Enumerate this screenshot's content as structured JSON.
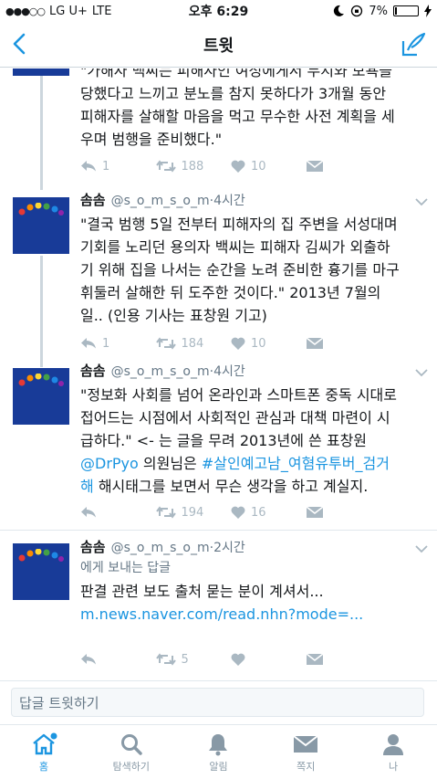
{
  "status_bar": {
    "signal": "●●●○○",
    "carrier": "LG U+",
    "network": "LTE",
    "time": "오후 6:29",
    "battery": "7%",
    "battery_level": 0.07
  },
  "nav": {
    "title": "트윗"
  },
  "tweets": [
    {
      "body_lines": [
        "\"가해자 백씨는 피해자인 여성에게서 무시와 모욕을",
        "당했다고 느끼고 분노를 참지 못하다가 3개월 동안",
        "피해자를 살해할 마음을 먹고 무수한 사전 계획을 세",
        "우며 범행을 준비했다.\""
      ],
      "reply_count": "1",
      "retweet_count": "188",
      "like_count": "10"
    },
    {
      "name": "솜솜",
      "handle": "@s_o_m_s_o_m",
      "time": "4시간",
      "body_lines": [
        "\"결국 범행 5일 전부터 피해자의 집 주변을 서성대며",
        "기회를 노리던 용의자 백씨는 피해자 김씨가 외출하",
        "기 위해 집을 나서는 순간을 노려 준비한 흉기를 마구",
        "휘둘러 살해한 뒤 도주한 것이다.\" 2013년 7월의",
        "일.. (인용 기사는 표창원 기고)"
      ],
      "reply_count": "1",
      "retweet_count": "184",
      "like_count": "10"
    },
    {
      "name": "솜솜",
      "handle": "@s_o_m_s_o_m",
      "time": "4시간",
      "body_lines": [
        "\"정보화 사회를 넘어 온라인과 스마트폰 중독 시대로",
        "접어드는 시점에서 사회적인 관심과 대책 마련이 시",
        "급하다.\" <- 는 글을 무려 2013년에 쓴 표창원"
      ],
      "mention": "@DrPyo",
      "mention_suffix": " 의원님은 ",
      "hashtag_line1": "#살인예고남_여혐유투버_검거",
      "hashtag_line2": "해",
      "hashtag_suffix": " 해시태그를 보면서 무슨 생각을 하고 계실지.",
      "reply_count": "",
      "retweet_count": "194",
      "like_count": "16"
    },
    {
      "name": "솜솜",
      "handle": "@s_o_m_s_o_m",
      "time": "2시간",
      "reply_to": "에게 보내는 답글",
      "body_lines": [
        "판결 관련 보도 출처 묻는 분이 계셔서..."
      ],
      "link": "m.news.naver.com/read.nhn?mode=...",
      "reply_count": "",
      "retweet_count": "5",
      "like_count": ""
    }
  ],
  "compose": {
    "placeholder": "답글 트윗하기"
  },
  "tabs": [
    {
      "label": "홈"
    },
    {
      "label": "탐색하기"
    },
    {
      "label": "알림"
    },
    {
      "label": "쪽지"
    },
    {
      "label": "나"
    }
  ],
  "colors": {
    "accent": "#1b95e0",
    "avatar_bg": "#183b98"
  },
  "icons": [
    "back-chevron-icon",
    "compose-icon",
    "reply-icon",
    "retweet-icon",
    "heart-icon",
    "dm-icon",
    "home-icon",
    "search-icon",
    "bell-icon",
    "envelope-icon",
    "person-icon"
  ]
}
